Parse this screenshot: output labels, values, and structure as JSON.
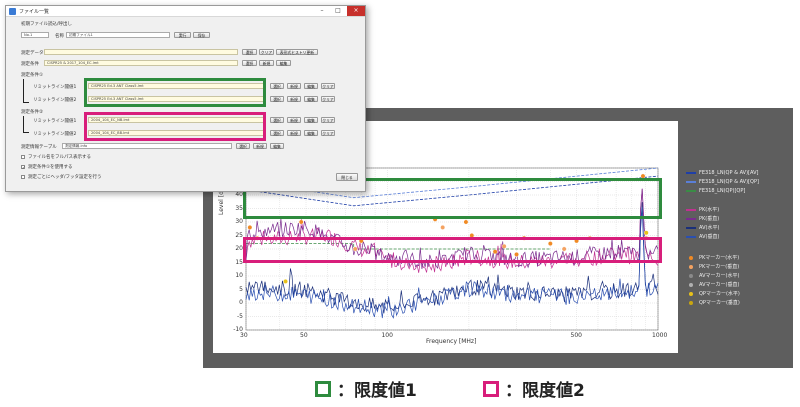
{
  "colors": {
    "limit1": "#2e8b3e",
    "limit2": "#d81e7b",
    "chart_bg": "#5e5e5e"
  },
  "dialog": {
    "title": "ファイル一覧",
    "initial_file_label": "初期ファイル読込/呼出し",
    "no_select": "No.1",
    "name_label": "名称",
    "name_value": "初期ファイル1",
    "run_btn": "実行",
    "save_btn": "保存",
    "test_data_label": "測定データ",
    "condition_label": "測定条件",
    "condition_value": "CISPR25 & 2017_104_EC.lmt",
    "select_btn": "選択",
    "clear_btn": "クリア",
    "history_btn": "表形式ヒストリ更新",
    "new_btn": "新規",
    "edit_btn": "編集",
    "limit_section1": "測定条件①",
    "limit_section2": "測定条件②",
    "limit_row_label_a": "リミットライン閾値1",
    "limit_row_label_b": "リミットライン閾値2",
    "limit1_a": "CISPR25 Ed.3 ANT Class5.lmt",
    "limit1_b": "CISPR25 Ed.3 ANT Class5.lmt",
    "limit2_a": "2004_104_EC_NB.lmt",
    "limit2_b": "2004_104_EC_BB.lmt",
    "table_label": "測定情報テーブル",
    "table_value": "測定情報.info",
    "opt1": "ファイル名をフルパス表示する",
    "opt2": "測定条件①を使用する",
    "opt3": "測定ごとにヘッダ/フッタ設定を行う",
    "close_btn": "閉じる"
  },
  "chart_data": {
    "type": "line",
    "xlabel": "Frequency [MHz]",
    "ylabel": "Level [dBμV/m]",
    "xscale": "log",
    "xlim": [
      30,
      1000
    ],
    "ylim": [
      -10,
      50
    ],
    "xticks": [
      {
        "v": 30,
        "t": "30"
      },
      {
        "v": 50,
        "t": "50"
      },
      {
        "v": 100,
        "t": "100"
      },
      {
        "v": 500,
        "t": "500"
      },
      {
        "v": 1000,
        "t": "1000"
      }
    ],
    "yticks": [
      -10,
      -5,
      0,
      5,
      10,
      15,
      20,
      25,
      30,
      35,
      40,
      45,
      50
    ],
    "grid": true,
    "series": [
      {
        "name": "FE318_LN(QP & AV)[AV]",
        "color": "#1f3fa8",
        "style": "dash",
        "x": [
          30,
          75,
          200,
          1000
        ],
        "y": [
          42,
          36,
          40,
          47
        ]
      },
      {
        "name": "FE318_LN(QP & AV)[QP]",
        "color": "#5a7fd8",
        "style": "dash",
        "x": [
          30,
          75,
          200,
          1000
        ],
        "y": [
          45,
          39,
          43,
          50
        ]
      },
      {
        "name": "FE318_LN(QP)[QP]",
        "color": "#3a8c46",
        "style": "dash",
        "x": [
          30,
          75,
          75,
          400
        ],
        "y": [
          22,
          22,
          20,
          20
        ]
      },
      {
        "name": "PK(水平)",
        "color": "#c03090",
        "style": "noise",
        "x": [
          30,
          60,
          100,
          150,
          200,
          300,
          500,
          700,
          850,
          870,
          900,
          1000
        ],
        "y": [
          23,
          25,
          16,
          13,
          17,
          15,
          16,
          18,
          17,
          46,
          17,
          16
        ]
      },
      {
        "name": "PK(垂直)",
        "color": "#7a2c8e",
        "style": "noise",
        "x": [
          30,
          50,
          75,
          100,
          150,
          200,
          300,
          500,
          700,
          850,
          870,
          900,
          1000
        ],
        "y": [
          26,
          28,
          20,
          17,
          15,
          18,
          16,
          17,
          19,
          18,
          46,
          18,
          17
        ]
      },
      {
        "name": "AV(水平)",
        "color": "#1a2f7a",
        "style": "noise",
        "x": [
          30,
          50,
          75,
          100,
          150,
          200,
          300,
          500,
          800,
          850,
          870,
          900,
          1000
        ],
        "y": [
          6,
          5,
          0,
          -2,
          2,
          6,
          4,
          3,
          5,
          5,
          42,
          6,
          5
        ]
      },
      {
        "name": "AV(垂直)",
        "color": "#2a4fb0",
        "style": "noise",
        "x": [
          30,
          50,
          75,
          100,
          150,
          200,
          300,
          500,
          800,
          850,
          870,
          900,
          1000
        ],
        "y": [
          4,
          3,
          -1,
          -3,
          1,
          5,
          3,
          2,
          4,
          4,
          40,
          5,
          4
        ]
      }
    ],
    "markers": [
      {
        "name": "PKマーカー(水平)",
        "color": "#f08a24",
        "points": [
          [
            31,
            28
          ],
          [
            48,
            30
          ],
          [
            80,
            23
          ],
          [
            150,
            31
          ],
          [
            195,
            30
          ],
          [
            205,
            25
          ],
          [
            250,
            19
          ],
          [
            300,
            18
          ],
          [
            320,
            24
          ],
          [
            400,
            22
          ],
          [
            500,
            23
          ],
          [
            880,
            47
          ]
        ]
      },
      {
        "name": "PKマーカー(垂直)",
        "color": "#f4a261",
        "points": [
          [
            33,
            24
          ],
          [
            76,
            20
          ],
          [
            160,
            28
          ],
          [
            270,
            21
          ],
          [
            450,
            20
          ],
          [
            560,
            24
          ],
          [
            905,
            24
          ]
        ]
      },
      {
        "name": "AVマーカー(水平)",
        "color": "#8a8a8a",
        "points": []
      },
      {
        "name": "AVマーカー(垂直)",
        "color": "#b0b0b0",
        "points": []
      },
      {
        "name": "QPマーカー(水平)",
        "color": "#e8c21a",
        "points": [
          [
            42,
            8
          ],
          [
            905,
            26
          ]
        ]
      },
      {
        "name": "QPマーカー(垂直)",
        "color": "#c9a60f",
        "points": []
      }
    ]
  },
  "key": {
    "limit1": "：限度値1",
    "limit2": "：限度値2"
  }
}
